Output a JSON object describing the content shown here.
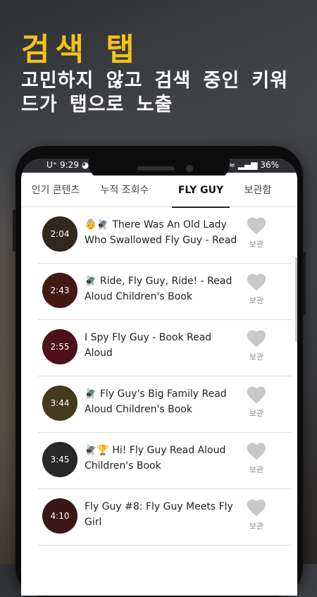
{
  "promo": {
    "title": "검색 탭",
    "subtitle": "고민하지 않고 검색 중인 키워드가 탭으로 노출"
  },
  "status_bar": {
    "carrier": "U⁺",
    "time": "9:29",
    "battery": "36%"
  },
  "tabs": [
    {
      "label": "인기 콘텐츠",
      "active": false
    },
    {
      "label": "누적 조회수",
      "active": false
    },
    {
      "label": "FLY GUY",
      "active": true
    },
    {
      "label": "보관함",
      "active": false
    }
  ],
  "videos": [
    {
      "duration": "2:04",
      "title": "👵🪰 There Was An Old Lady Who Swallowed Fly Guy - Read",
      "fav_label": "보관",
      "thumb_color": "#5a4a3a"
    },
    {
      "duration": "2:43",
      "title": "🪰 Ride, Fly Guy, Ride! - Read Aloud Children's Book",
      "fav_label": "보관",
      "thumb_color": "#7a2e24"
    },
    {
      "duration": "2:55",
      "title": "I Spy Fly Guy - Book Read Aloud",
      "fav_label": "보관",
      "thumb_color": "#8a2030"
    },
    {
      "duration": "3:44",
      "title": "🪰 Fly Guy's Big Family Read Aloud Children's Book",
      "fav_label": "보관",
      "thumb_color": "#7a6a3a"
    },
    {
      "duration": "3:45",
      "title": "🪰🏆 Hi! Fly Guy Read Aloud Children's Book",
      "fav_label": "보관",
      "thumb_color": "#4a4a4a"
    },
    {
      "duration": "4:10",
      "title": "Fly Guy #8: Fly Guy Meets Fly Girl",
      "fav_label": "보관",
      "thumb_color": "#6a2a2a"
    }
  ],
  "colors": {
    "accent_gold": "#f2c21a",
    "heart": "#c8c8c8",
    "status_bar": "#2e2e35"
  }
}
